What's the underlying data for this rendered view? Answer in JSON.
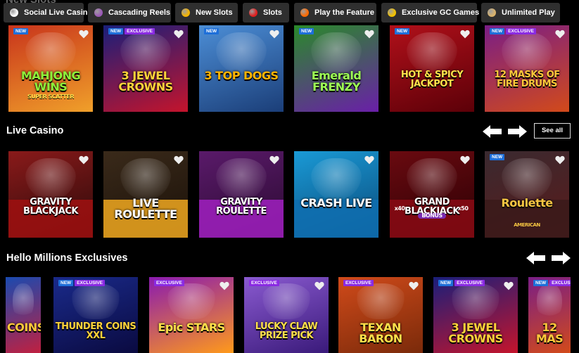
{
  "top_bar": {
    "ghost_title": "New Slots",
    "pills": [
      {
        "label": "Social Live Casino",
        "icon": "dice-icon",
        "color": "#ffffff"
      },
      {
        "label": "Cascading Reels",
        "icon": "grapes-icon",
        "color": "#9b59b6"
      },
      {
        "label": "New Slots",
        "icon": "bell-icon",
        "color": "#f5b400"
      },
      {
        "label": "Slots",
        "icon": "cherry-icon",
        "color": "#e02020"
      },
      {
        "label": "Play the Feature",
        "icon": "explosion-icon",
        "color": "#ff6a00"
      },
      {
        "label": "Exclusive GC Games",
        "icon": "coin-icon",
        "color": "#f2c200"
      },
      {
        "label": "Unlimited Play",
        "icon": "hourglass-icon",
        "color": "#d9b26b"
      }
    ]
  },
  "badges": {
    "new": "NEW",
    "exclusive": "EXCLUSIVE"
  },
  "new_slots": [
    {
      "name": "MAHJONG WINS",
      "sub": "SUPER SCATTER",
      "new": true,
      "exclusive": false,
      "bg": "#c8341c",
      "bg2": "#f0a02a",
      "text": "#8ef03a"
    },
    {
      "name": "3 JEWEL CROWNS",
      "sub": "",
      "new": true,
      "exclusive": true,
      "bg": "#1a1f7a",
      "bg2": "#c4142c",
      "text": "#ffd23a"
    },
    {
      "name": "3 TOP DOGS",
      "sub": "",
      "new": true,
      "exclusive": false,
      "bg": "#4c8ed6",
      "bg2": "#1b3e78",
      "text": "#ffb400"
    },
    {
      "name": "Emerald FRENZY",
      "sub": "",
      "new": true,
      "exclusive": false,
      "bg": "#2a8a2a",
      "bg2": "#6a1fa8",
      "text": "#9dff55"
    },
    {
      "name": "HOT & SPICY JACKPOT",
      "sub": "",
      "new": true,
      "exclusive": false,
      "bg": "#b0101a",
      "bg2": "#5c0008",
      "text": "#ffe24a"
    },
    {
      "name": "12 MASKS OF FIRE DRUMS",
      "sub": "",
      "new": true,
      "exclusive": true,
      "bg": "#7a1e86",
      "bg2": "#d24a1a",
      "text": "#ffc83a"
    }
  ],
  "live_casino": {
    "title": "Live Casino",
    "see_all": "See all",
    "tiles": [
      {
        "name": "GRAVITY BLACKJACK",
        "new": false,
        "bg": "#8a1a1a",
        "bg2": "#2a0a0a",
        "text": "#ffffff",
        "band": "#a01010"
      },
      {
        "name": "LIVE ROULETTE",
        "new": false,
        "bg": "#3a2a1a",
        "bg2": "#1a1008",
        "text": "#ffffff",
        "band": "#f0a820"
      },
      {
        "name": "GRAVITY ROULETTE",
        "new": false,
        "bg": "#5a1a6a",
        "bg2": "#2a0a30",
        "text": "#ffffff",
        "band": "#a020c0"
      },
      {
        "name": "CRASH LIVE",
        "new": false,
        "bg": "#1a9ad6",
        "bg2": "#0a4a7a",
        "text": "#ffffff",
        "band": "#0f6fb0"
      },
      {
        "name": "GRAND BLACKJACK",
        "new": false,
        "bg": "#6a0a10",
        "bg2": "#2a0004",
        "text": "#ffffff",
        "band": "#8a0a14"
      },
      {
        "name": "Roulette",
        "new": true,
        "bg": "#3a2a30",
        "bg2": "#5a1a1a",
        "text": "#f5c542",
        "band": "#3a1a1a"
      }
    ]
  },
  "live_casino_extra": {
    "grand_sub": "BONUS",
    "x40": "x40",
    "x50": "x50",
    "american": "AMERICAN"
  },
  "exclusives": {
    "title": "Hello Millions Exclusives",
    "tiles": [
      {
        "name": "COINS",
        "new": false,
        "exclusive": false,
        "bg": "#1a4ab0",
        "bg2": "#c02040",
        "text": "#ffc83a"
      },
      {
        "name": "THUNDER COINS XXL",
        "new": true,
        "exclusive": true,
        "bg": "#1a2a8a",
        "bg2": "#0a0a40",
        "text": "#ffd23a"
      },
      {
        "name": "Epic STARS",
        "new": false,
        "exclusive": true,
        "bg": "#8a1ab0",
        "bg2": "#ff9a1a",
        "text": "#ffe04a"
      },
      {
        "name": "LUCKY CLAW PRIZE PICK",
        "new": false,
        "exclusive": true,
        "bg": "#8a5ad0",
        "bg2": "#3a1a7a",
        "text": "#ffe04a"
      },
      {
        "name": "TEXAN BARON",
        "new": false,
        "exclusive": true,
        "bg": "#d04a1a",
        "bg2": "#7a2a0a",
        "text": "#ffe04a"
      },
      {
        "name": "3 JEWEL CROWNS",
        "new": true,
        "exclusive": true,
        "bg": "#1a1f7a",
        "bg2": "#c4142c",
        "text": "#ffd23a"
      },
      {
        "name": "12 MAS",
        "new": true,
        "exclusive": true,
        "bg": "#7a1e86",
        "bg2": "#d24a1a",
        "text": "#ffc83a"
      }
    ]
  }
}
